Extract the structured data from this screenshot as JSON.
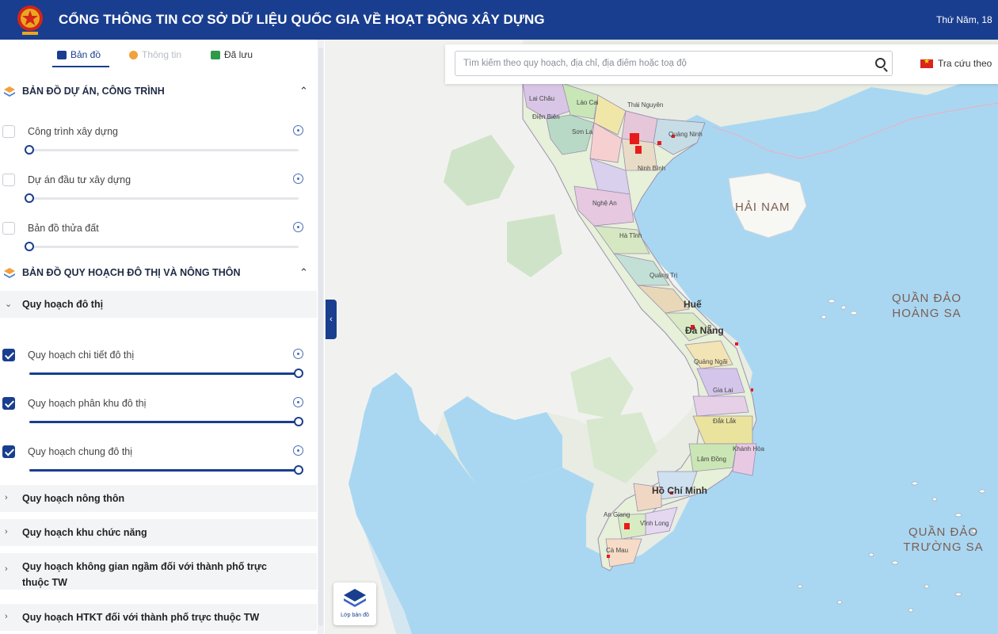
{
  "header": {
    "title": "CỔNG THÔNG TIN CƠ SỞ DỮ LIỆU QUỐC GIA VỀ HOẠT ĐỘNG XÂY DỰNG",
    "date": "Thứ Năm, 18"
  },
  "tabs": {
    "map": "Bản đồ",
    "info": "Thông tin",
    "saved": "Đã lưu"
  },
  "sections": {
    "projects": {
      "title": "BẢN ĐỒ DỰ ÁN, CÔNG TRÌNH",
      "layers": [
        {
          "label": "Công trình xây dựng",
          "checked": false,
          "opacity": 0
        },
        {
          "label": "Dự án đầu tư xây dựng",
          "checked": false,
          "opacity": 0
        },
        {
          "label": "Bản đồ thửa đất",
          "checked": false,
          "opacity": 0
        }
      ]
    },
    "planning": {
      "title": "BẢN ĐỒ QUY HOẠCH ĐÔ THỊ VÀ NÔNG THÔN",
      "urban_group": "Quy hoạch đô thị",
      "layers": [
        {
          "label": "Quy hoạch chi tiết đô thị",
          "checked": true,
          "opacity": 1
        },
        {
          "label": "Quy hoạch phân khu đô thị",
          "checked": true,
          "opacity": 1
        },
        {
          "label": "Quy hoạch chung đô thị",
          "checked": true,
          "opacity": 1
        }
      ],
      "groups": [
        "Quy hoạch nông thôn",
        "Quy hoạch khu chức năng",
        "Quy hoạch không gian ngầm đối với thành phố trực thuộc TW",
        "Quy hoạch HTKT đối với thành phố trực thuộc TW"
      ]
    }
  },
  "search": {
    "placeholder": "Tìm kiếm theo quy hoạch, địa chỉ, địa điểm hoặc toạ độ",
    "lookup_label": "Tra cứu theo"
  },
  "map": {
    "labels": {
      "hainam": "HẢI NAM",
      "hoangsa": "QUẦN ĐẢO HOÀNG SA",
      "truongsa": "QUẦN ĐẢO TRƯỜNG SA"
    },
    "cities": {
      "hue": "Huế",
      "danang": "Đà Nẵng",
      "hcm": "Hồ Chí Minh"
    },
    "provinces": [
      "Lai Châu",
      "Lào Cai",
      "Thái Nguyên",
      "Điện Biên",
      "Sơn La",
      "Quảng Ninh",
      "Ninh Bình",
      "Nghệ An",
      "Hà Tĩnh",
      "Quảng Trị",
      "Quảng Ngãi",
      "Gia Lai",
      "Đắk Lắk",
      "Khánh Hòa",
      "Lâm Đồng",
      "An Giang",
      "Vĩnh Long",
      "Cà Mau"
    ],
    "layer_button": "Lớp bản đồ"
  }
}
